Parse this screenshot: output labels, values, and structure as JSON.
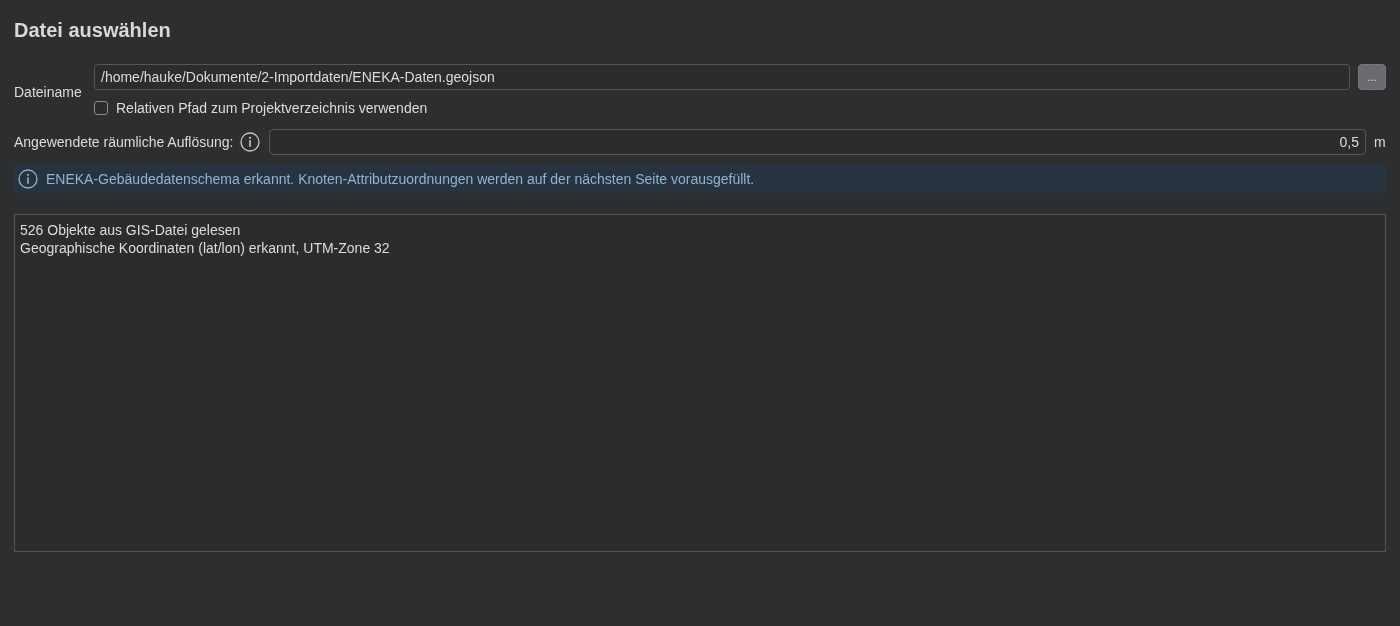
{
  "title": "Datei auswählen",
  "file": {
    "label": "Dateiname",
    "value": "/home/hauke/Dokumente/2-Importdaten/ENEKA-Daten.geojson",
    "browse_button": "...",
    "relative_path": {
      "label": "Relativen Pfad zum Projektverzeichnis verwenden",
      "checked": false
    }
  },
  "resolution": {
    "label": "Angewendete räumliche Auflösung:",
    "value": "0,5",
    "unit": "m"
  },
  "info_banner": {
    "text": "ENEKA-Gebäudedatenschema erkannt. Knoten-Attributzuordnungen werden auf der nächsten Seite vorausgefüllt."
  },
  "log": {
    "lines": [
      "526 Objekte aus GIS-Datei gelesen",
      "Geographische Koordinaten (lat/lon) erkannt, UTM-Zone 32"
    ]
  }
}
